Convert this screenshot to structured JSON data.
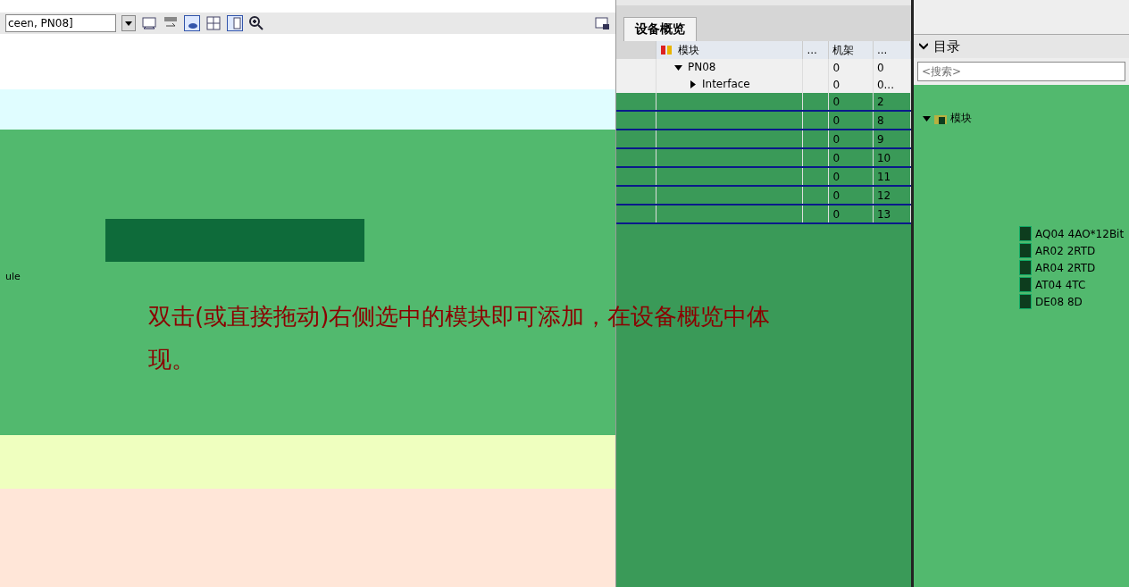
{
  "toolbar": {
    "device_select": "ceen, PN08]"
  },
  "canvas": {
    "label": "ule",
    "annotation": "双击(或直接拖动)右侧选中的模块即可添加，在设备概览中体现。"
  },
  "overview": {
    "tab": "设备概览",
    "columns": [
      "模块",
      "...",
      "机架",
      "..."
    ],
    "rows": [
      {
        "kind": "device",
        "name": "PN08",
        "expanded": true,
        "rack": "0",
        "slot": "0",
        "children": [
          {
            "kind": "device",
            "name": "Interface",
            "expanded": false,
            "rack": "0",
            "slot": "0..."
          }
        ]
      },
      {
        "kind": "slot",
        "rack": "0",
        "slot": "2"
      },
      {
        "kind": "slot",
        "rack": "0",
        "slot": "8"
      },
      {
        "kind": "slot",
        "rack": "0",
        "slot": "9"
      },
      {
        "kind": "slot",
        "rack": "0",
        "slot": "10"
      },
      {
        "kind": "slot",
        "rack": "0",
        "slot": "11"
      },
      {
        "kind": "slot",
        "rack": "0",
        "slot": "12"
      },
      {
        "kind": "slot",
        "rack": "0",
        "slot": "13"
      }
    ]
  },
  "catalog": {
    "title": "目录",
    "search": {
      "placeholder": "<搜索>"
    },
    "tree": [
      {
        "label": "模块",
        "expanded": true,
        "children": [
          {
            "label": "AQ04 4AO*12Bit"
          },
          {
            "label": "AR02 2RTD"
          },
          {
            "label": "AR04 2RTD"
          },
          {
            "label": "AT04 4TC"
          },
          {
            "label": "DE08 8D"
          }
        ]
      }
    ]
  }
}
